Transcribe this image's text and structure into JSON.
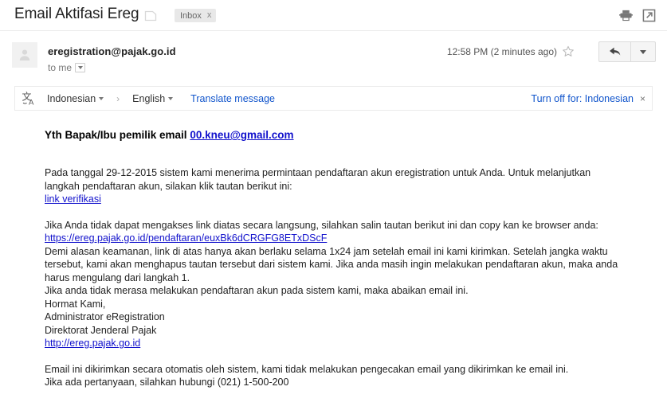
{
  "header": {
    "subject": "Email Aktifasi Ereg",
    "label_chip": {
      "text": "Inbox",
      "close": "x"
    },
    "icons": {
      "print": "print-icon",
      "popout": "open-in-new-window-icon",
      "preview": "print-preview-icon"
    }
  },
  "message": {
    "sender": "eregistration@pajak.go.id",
    "recipient": "to me",
    "timestamp": "12:58 PM (2 minutes ago)",
    "star": "star-icon",
    "reply": "reply-icon",
    "more": "more-options-icon",
    "avatar": "default-avatar-icon"
  },
  "translate": {
    "icon": "translate-icon",
    "source_language": "Indonesian",
    "separator": "›",
    "target_language": "English",
    "translate_message": "Translate message",
    "turn_off": "Turn off for: Indonesian",
    "close": "×"
  },
  "body": {
    "greeting_prefix": "Yth Bapak/Ibu pemilik email ",
    "greeting_email": "00.kneu@gmail.com",
    "p1": "Pada tanggal 29-12-2015 sistem kami menerima permintaan pendaftaran akun eregistration untuk Anda. Untuk melanjutkan langkah pendaftaran akun, silakan klik tautan berikut ini:",
    "p1_link": "link verifikasi",
    "p2_prefix": "Jika Anda tidak dapat mengakses link diatas secara langsung, silahkan salin tautan berikut ini dan copy kan ke browser anda: ",
    "p2_link": "https://ereg.pajak.go.id/pendaftaran/euxBk6dCRGFG8ETxDScF",
    "p3": "Demi alasan keamanan, link di atas hanya akan berlaku selama 1x24 jam setelah email ini kami kirimkan. Setelah jangka waktu tersebut, kami akan menghapus tautan tersebut dari sistem kami. Jika anda masih ingin melakukan pendaftaran akun, maka anda harus mengulang dari langkah 1.",
    "p4": "Jika anda tidak merasa melakukan pendaftaran akun pada sistem kami, maka abaikan email ini.",
    "sig_1": "Hormat Kami,",
    "sig_2": "Administrator eRegistration",
    "sig_3": "Direktorat Jenderal Pajak",
    "sig_link": "http://ereg.pajak.go.id",
    "p5": "Email ini dikirimkan secara otomatis oleh sistem, kami tidak melakukan pengecakan email yang dikirimkan ke email ini.",
    "p6": "Jika ada pertanyaan, silahkan hubungi (021) 1-500-200"
  },
  "colors": {
    "link_blue": "#1111cc",
    "ui_link_blue": "#1155cc",
    "text": "#222222",
    "chip_bg": "#e8e8e8"
  }
}
